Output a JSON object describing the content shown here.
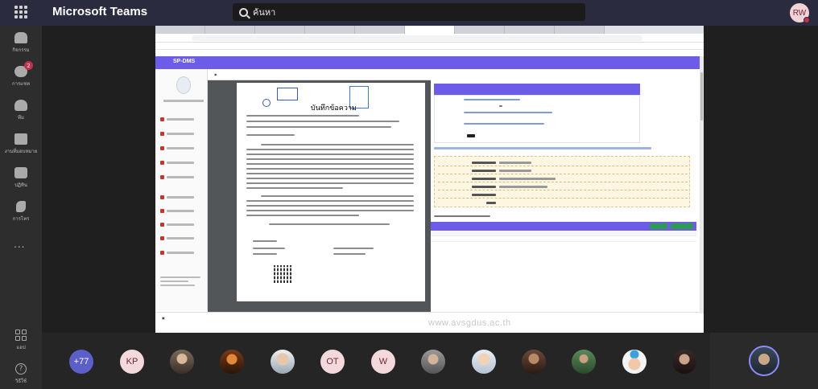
{
  "app": {
    "title": "Microsoft Teams"
  },
  "search": {
    "placeholder": "ค้นหา"
  },
  "user": {
    "initials": "RW"
  },
  "rail": {
    "items": [
      {
        "label": "กิจกรรม",
        "icon": "bell-icon"
      },
      {
        "label": "การแชท",
        "icon": "chat-icon",
        "badge": "2"
      },
      {
        "label": "ทีม",
        "icon": "teams-icon"
      },
      {
        "label": "งานที่มอบหมาย",
        "icon": "assignments-icon"
      },
      {
        "label": "ปฏิทิน",
        "icon": "calendar-icon"
      },
      {
        "label": "การโทร",
        "icon": "calls-icon"
      }
    ],
    "more": "...",
    "apps_label": "แอป",
    "help_label": "วิธีใช้"
  },
  "shared_screen": {
    "site_logo": "SP-DMS",
    "doc_title": "บันทึกข้อความ",
    "watermark": "www.avsgdus.ac.th"
  },
  "participants": {
    "overflow": "+77",
    "tiles": [
      {
        "initials": "KP",
        "bg": "#f4d9dc",
        "fg": "#6b2a3a"
      },
      {
        "initials": "",
        "photo": true
      },
      {
        "initials": "",
        "photo": true
      },
      {
        "initials": "",
        "photo": true
      },
      {
        "initials": "OT",
        "bg": "#f4d9dc",
        "fg": "#6b2a3a"
      },
      {
        "initials": "W",
        "bg": "#f4d9dc",
        "fg": "#6b2a3a"
      },
      {
        "initials": "",
        "photo": true
      },
      {
        "initials": "",
        "photo": true
      },
      {
        "initials": "",
        "photo": true
      },
      {
        "initials": "",
        "photo": true
      },
      {
        "initials": "",
        "photo": true
      },
      {
        "initials": "",
        "photo": true
      }
    ]
  },
  "colors": {
    "accent": "#6c5ce7",
    "header": "#2b2b40",
    "overflow_tile": "#5b5fc7"
  }
}
